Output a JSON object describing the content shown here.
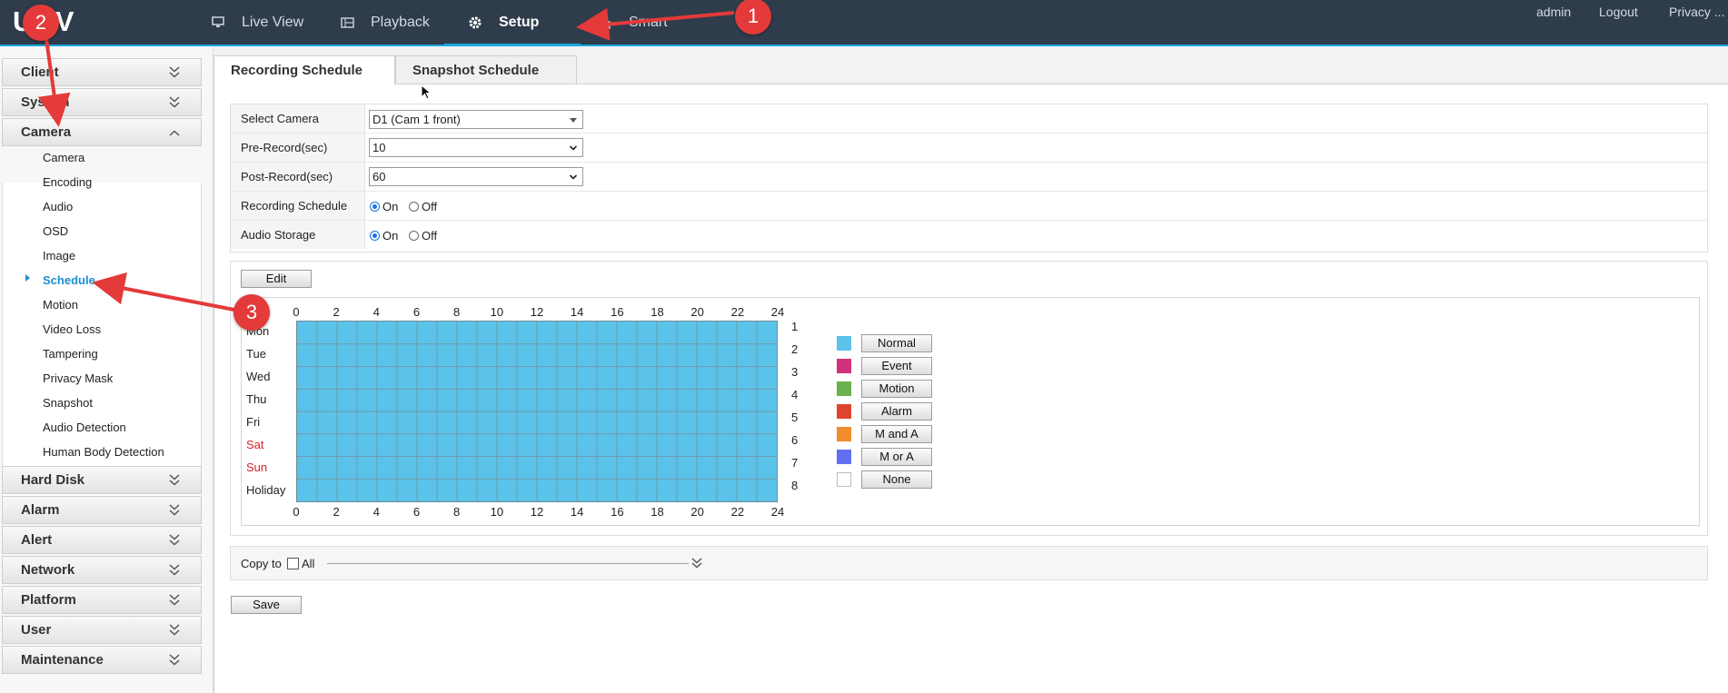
{
  "app": {
    "logo": "UNV"
  },
  "topnav": {
    "items": [
      {
        "label": "Live View",
        "icon": "monitor-icon"
      },
      {
        "label": "Playback",
        "icon": "playback-icon"
      },
      {
        "label": "Setup",
        "icon": "gear-icon",
        "active": true
      },
      {
        "label": "Smart",
        "icon": "smart-icon"
      }
    ],
    "links": [
      "admin",
      "Logout",
      "Privacy ..."
    ]
  },
  "sidebar": {
    "sections": [
      "Client",
      "System",
      "Camera",
      "Hard Disk",
      "Alarm",
      "Alert",
      "Network",
      "Platform",
      "User",
      "Maintenance"
    ],
    "expanded": "Camera",
    "camera_items": [
      "Camera",
      "Encoding",
      "Audio",
      "OSD",
      "Image",
      "Schedule",
      "Motion",
      "Video Loss",
      "Tampering",
      "Privacy Mask",
      "Snapshot",
      "Audio Detection",
      "Human Body Detection"
    ],
    "active_item": "Schedule"
  },
  "tabs": [
    {
      "label": "Recording Schedule",
      "active": true
    },
    {
      "label": "Snapshot Schedule",
      "active": false
    }
  ],
  "form": {
    "select_camera": {
      "label": "Select Camera",
      "value": "D1 (Cam 1 front)"
    },
    "pre_record": {
      "label": "Pre-Record(sec)",
      "value": "10"
    },
    "post_record": {
      "label": "Post-Record(sec)",
      "value": "60"
    },
    "recording_schedule": {
      "label": "Recording Schedule",
      "on_label": "On",
      "off_label": "Off",
      "value": "On"
    },
    "audio_storage": {
      "label": "Audio Storage",
      "on_label": "On",
      "off_label": "Off",
      "value": "On"
    }
  },
  "schedule": {
    "edit_label": "Edit",
    "hours": [
      "0",
      "2",
      "4",
      "6",
      "8",
      "10",
      "12",
      "14",
      "16",
      "18",
      "20",
      "22",
      "24"
    ],
    "days": [
      "Mon",
      "Tue",
      "Wed",
      "Thu",
      "Fri",
      "Sat",
      "Sun",
      "Holiday"
    ],
    "weekend_color": "#e02020",
    "row_numbers": [
      "1",
      "2",
      "3",
      "4",
      "5",
      "6",
      "7",
      "8"
    ],
    "fill_color": "#5bc2e9",
    "fill_type": "Normal",
    "legend": [
      {
        "label": "Normal",
        "color": "#5bc2e9"
      },
      {
        "label": "Event",
        "color": "#d1307a"
      },
      {
        "label": "Motion",
        "color": "#6ab04c"
      },
      {
        "label": "Alarm",
        "color": "#e0452e"
      },
      {
        "label": "M and A",
        "color": "#ef8d2a"
      },
      {
        "label": "M or A",
        "color": "#6170f0"
      },
      {
        "label": "None",
        "color": "#ffffff"
      }
    ]
  },
  "copy": {
    "label": "Copy to",
    "all_label": "All",
    "checked": false
  },
  "save_label": "Save",
  "annotations": {
    "accent": "#e43a3a",
    "markers": [
      "1",
      "2",
      "3"
    ]
  }
}
